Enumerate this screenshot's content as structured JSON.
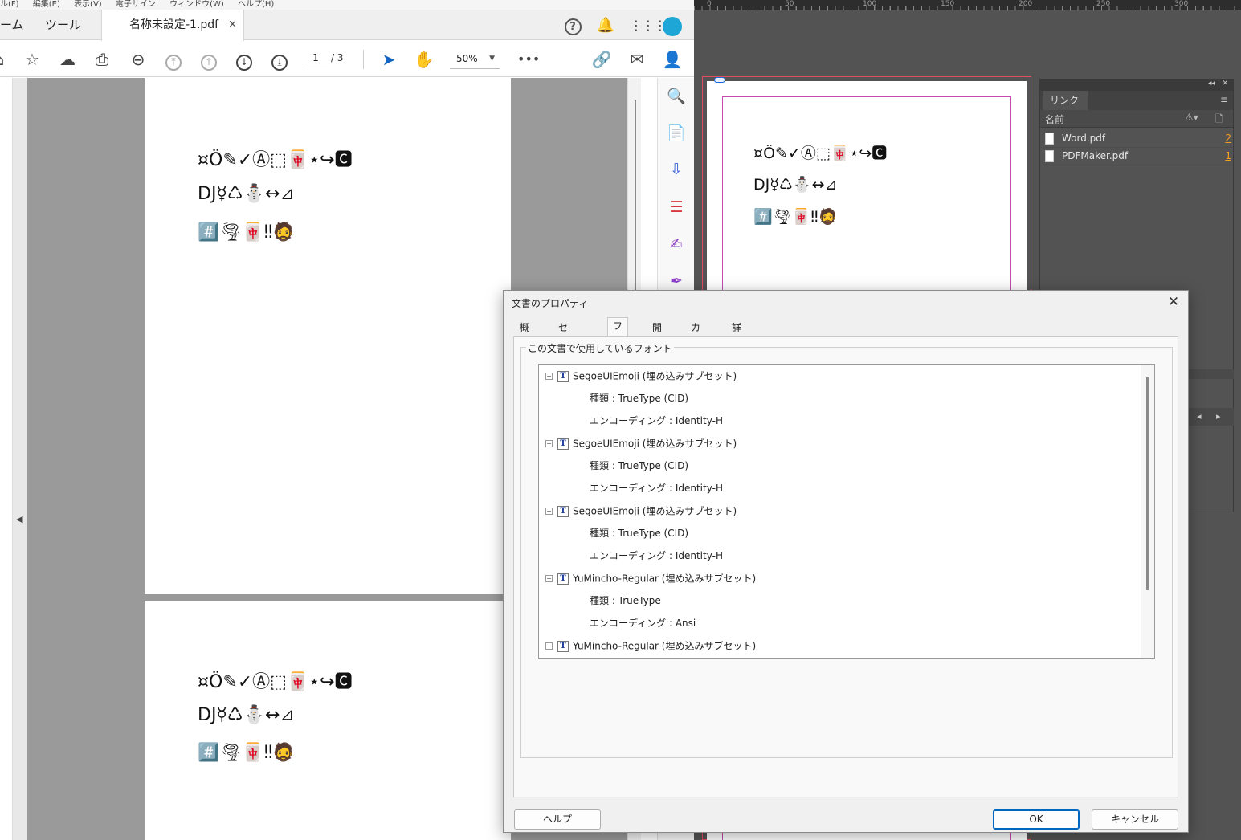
{
  "acrobat": {
    "menubar": [
      "ル(F)",
      "編集(E)",
      "表示(V)",
      "電子サイン",
      "ウィンドウ(W)",
      "ヘルプ(H)"
    ],
    "tabs": {
      "home": "ーム",
      "tools": "ツール",
      "document": "名称未設定-1.pdf",
      "close": "×"
    },
    "page_current": "1",
    "page_total": "/ 3",
    "zoom": "50%",
    "more": "•••",
    "glyph_lines": [
      "¤Ö✎✓Ⓐ⬚🀄⋆↪🅲",
      "DJ☿♺⛄↔⊿",
      "#️⃣🌪🀄‼🧔"
    ]
  },
  "indesign": {
    "ruler_labels": [
      "0",
      "50",
      "100",
      "150",
      "200",
      "250",
      "300"
    ],
    "links_panel": {
      "tab": "リンク",
      "column_name": "名前",
      "rows": [
        {
          "name": "Word.pdf",
          "page": "2"
        },
        {
          "name": "PDFMaker.pdf",
          "page": "1"
        }
      ]
    }
  },
  "dialog": {
    "title": "文書のプロパティ",
    "tabs": [
      "概要",
      "セキュリティ",
      "フォント",
      "開き方",
      "カスタム",
      "詳細設定"
    ],
    "active_tab": "フォント",
    "group_label": "この文書で使用しているフォント",
    "fonts": [
      {
        "name": "SegoeUIEmoji (埋め込みサブセット)",
        "type": "種類 : TrueType (CID)",
        "encoding": "エンコーディング : Identity-H"
      },
      {
        "name": "SegoeUIEmoji (埋め込みサブセット)",
        "type": "種類 : TrueType (CID)",
        "encoding": "エンコーディング : Identity-H"
      },
      {
        "name": "SegoeUIEmoji (埋め込みサブセット)",
        "type": "種類 : TrueType (CID)",
        "encoding": "エンコーディング : Identity-H"
      },
      {
        "name": "YuMincho-Regular (埋め込みサブセット)",
        "type": "種類 : TrueType",
        "encoding": "エンコーディング : Ansi"
      },
      {
        "name": "YuMincho-Regular (埋め込みサブセット)"
      }
    ],
    "buttons": {
      "help": "ヘルプ",
      "ok": "OK",
      "cancel": "キャンセル"
    }
  },
  "colors": {
    "accent": "#0067c0",
    "avatar": "#1ea7d6",
    "link_number": "#f0a020",
    "bleed_guide": "#e04f5f",
    "margin_guide": "#c44cb0"
  }
}
